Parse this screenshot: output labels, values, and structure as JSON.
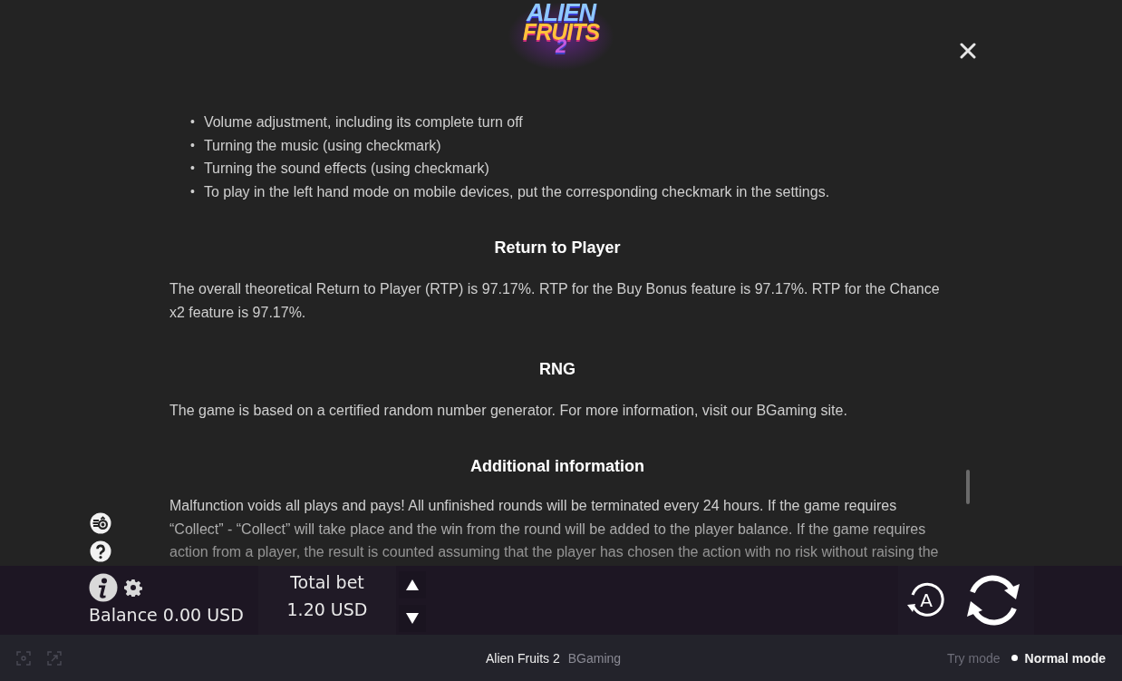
{
  "logo": {
    "line_1": "ALIEN",
    "line_2": "FRUITS",
    "line_3": "2"
  },
  "rules": {
    "bullets": [
      {
        "marker": "•",
        "text": "Volume adjustment, including its complete turn off"
      },
      {
        "marker": "•",
        "text": "Turning the music (using checkmark)"
      },
      {
        "marker": "•",
        "text": "Turning the sound effects (using checkmark)"
      },
      {
        "marker": "•",
        "text": "To play in the left hand mode on mobile devices, put the corresponding checkmark in the settings."
      }
    ],
    "sections": [
      {
        "heading": "Return to Player",
        "text": "The overall theoretical Return to Player (RTP) is 97.17%. RTP for the Buy Bonus feature is 97.17%. RTP for the Chance x2 feature is 97.17%."
      },
      {
        "heading": "RNG",
        "text": "The game is based on a certified random number generator. For more information, visit our BGaming site."
      },
      {
        "heading": "Additional information",
        "text": "Malfunction voids all plays and pays! All unfinished rounds will be terminated every 24 hours. If the game requires “Collect” - “Collect” will take place and the win from the round will be added to the player balance. If the game requires action from a player, the result is counted assuming that the player has chosen the action with no risk without raising the"
      }
    ]
  },
  "bar": {
    "balance": "Balance 0.00 USD",
    "total_bet_label": "Total bet",
    "total_bet_value": "1.20 USD",
    "autoplay_label": "A"
  },
  "footer": {
    "game_title": "Alien Fruits 2",
    "provider": "BGaming",
    "modes": [
      {
        "label": "Try mode",
        "selected": false
      },
      {
        "label": "Normal mode",
        "selected": true
      }
    ]
  }
}
